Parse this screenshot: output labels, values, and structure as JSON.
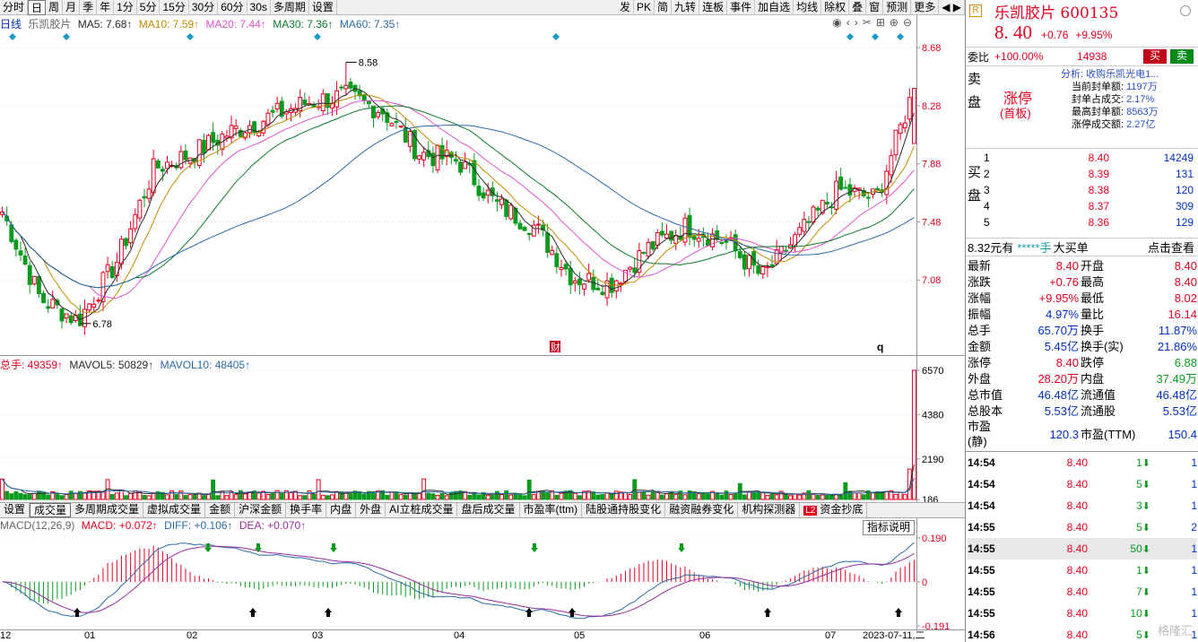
{
  "toolbar": {
    "left": [
      "分时",
      "日",
      "周",
      "月",
      "季",
      "年",
      "1分",
      "5分",
      "15分",
      "30分",
      "60分",
      "30s",
      "多周期",
      "设置"
    ],
    "right": [
      "发",
      "PK",
      "简",
      "九转",
      "连板",
      "事件",
      "加自选",
      "均线",
      "除权",
      "叠",
      "窗",
      "预测",
      "更多"
    ],
    "selected": "日"
  },
  "price_legend": {
    "kind": "日线",
    "stock": "乐凯胶片",
    "ma5": "MA5: 7.68↑",
    "ma10": "MA10: 7.59↑",
    "ma20": "MA20: 7.44↑",
    "ma30": "MA30: 7.36↑",
    "ma60": "MA60: 7.35↑"
  },
  "price_axis": [
    "8.68",
    "8.28",
    "7.88",
    "7.48",
    "7.08"
  ],
  "price_annot": {
    "high": "8.58",
    "low": "6.78",
    "marker_cai": "财",
    "marker_q": "q"
  },
  "vol_legend": {
    "total": "总手: 49359↑",
    "mavol5": "MAVOL5: 50829↑",
    "mavol10": "MAVOL10: 48405↑"
  },
  "vol_axis": [
    "6570",
    "4380",
    "2190",
    "186"
  ],
  "ind_tabs": [
    "设置",
    "成交量",
    "多周期成交量",
    "虚拟成交量",
    "金额",
    "沪深金额",
    "换手率",
    "内盘",
    "外盘",
    "AI立桩成交量",
    "盘后成交量",
    "市盈率(ttm)",
    "陆股通持股变化",
    "融资融券变化",
    "机构探测器",
    "资金抄底"
  ],
  "ind_selected": "成交量",
  "ind_badge": "L2",
  "macd_legend": {
    "name": "MACD(12,26,9)",
    "macd": "MACD: +0.072↑",
    "diff": "DIFF: +0.106↑",
    "dea": "DEA: +0.070↑"
  },
  "macd_axis": [
    "0.190",
    "0",
    "-0.191"
  ],
  "macd_help": "指标说明",
  "xaxis": [
    "12",
    "01",
    "02",
    "03",
    "04",
    "05",
    "06",
    "07",
    "2023-07-11,二"
  ],
  "colors": {
    "up": "#e4001e",
    "down": "#0a9a1f",
    "ma5": "#2a2a2a",
    "ma10": "#c48a00",
    "ma20": "#e052d0",
    "ma30": "#0a7a2a",
    "ma60": "#2a6aa8"
  },
  "chart_data": {
    "type": "candlestick",
    "title": "乐凯胶片 日线",
    "xlabel": "",
    "ylabel": "",
    "ylim": [
      6.68,
      8.78
    ],
    "x": [
      "12",
      "01",
      "02",
      "03",
      "04",
      "05",
      "06",
      "07"
    ],
    "keypoints": [
      {
        "x": "12",
        "close": 7.55
      },
      {
        "x": "12",
        "close": 6.95
      },
      {
        "x": "12",
        "close": 6.8
      },
      {
        "x": "01",
        "close": 7.2
      },
      {
        "x": "01",
        "close": 7.85
      },
      {
        "x": "01",
        "close": 7.95
      },
      {
        "x": "02",
        "close": 8.1
      },
      {
        "x": "02",
        "close": 8.2
      },
      {
        "x": "02",
        "close": 8.3
      },
      {
        "x": "03",
        "close": 8.35
      },
      {
        "x": "03",
        "close": 8.25
      },
      {
        "x": "03",
        "close": 7.95
      },
      {
        "x": "04",
        "close": 7.9
      },
      {
        "x": "04",
        "close": 7.6
      },
      {
        "x": "04",
        "close": 7.45
      },
      {
        "x": "05",
        "close": 7.1
      },
      {
        "x": "05",
        "close": 7.05
      },
      {
        "x": "05",
        "close": 7.3
      },
      {
        "x": "06",
        "close": 7.45
      },
      {
        "x": "06",
        "close": 7.35
      },
      {
        "x": "06",
        "close": 7.1
      },
      {
        "x": "07",
        "close": 7.4
      },
      {
        "x": "07",
        "close": 7.7
      },
      {
        "x": "07",
        "close": 7.64
      },
      {
        "x": "07",
        "close": 8.4
      }
    ],
    "annotations": {
      "high": 8.58,
      "low": 6.78
    },
    "last_close": 8.4,
    "volume_ylim": [
      186,
      6570
    ],
    "macd_ylim": [
      -0.191,
      0.19
    ]
  },
  "rp": {
    "logo": "R",
    "name": "乐凯胶片",
    "code": "600135",
    "price": "8. 40",
    "change": "+0.76",
    "pct": "+9.95%",
    "weibi_label": "委比",
    "weibi_pct": "+100.00%",
    "weibi_val": "14938",
    "buy_btn": "买",
    "sell_btn": "卖",
    "sell_side": "卖盘",
    "buy_side": "买盘",
    "limit_title": "涨停",
    "limit_sub": "(首板)",
    "limit_info": {
      "analysis": "分析: 收购乐凯光电1...",
      "rows": [
        [
          "当前封单额:",
          "1197万"
        ],
        [
          "封单占成交:",
          "2.17%"
        ],
        [
          "最高封单额:",
          "8563万"
        ],
        [
          "涨停成交额:",
          "2.27亿"
        ]
      ]
    },
    "bids": [
      [
        "1",
        "8.40",
        "14249"
      ],
      [
        "2",
        "8.39",
        "131"
      ],
      [
        "3",
        "8.38",
        "120"
      ],
      [
        "4",
        "8.37",
        "309"
      ],
      [
        "5",
        "8.36",
        "129"
      ]
    ],
    "bigorder": {
      "price": "8.32元有",
      "stars": "*****手",
      "label": "大买单",
      "link": "点击查看"
    },
    "stats": [
      [
        "最新",
        "8.40",
        "开盘",
        "8.40"
      ],
      [
        "涨跌",
        "+0.76",
        "最高",
        "8.40"
      ],
      [
        "涨幅",
        "+9.95%",
        "最低",
        "8.02"
      ],
      [
        "振幅",
        "4.97%",
        "量比",
        "16.14"
      ],
      [
        "总手",
        "65.70万",
        "换手",
        "11.87%"
      ],
      [
        "金额",
        "5.45亿",
        "换手(实)",
        "21.86%"
      ],
      [
        "涨停",
        "8.40",
        "跌停",
        "6.88"
      ],
      [
        "外盘",
        "28.20万",
        "内盘",
        "37.49万"
      ],
      [
        "总市值",
        "46.48亿",
        "流通值",
        "46.48亿"
      ],
      [
        "总股本",
        "5.53亿",
        "流通股",
        "5.53亿"
      ],
      [
        "市盈(静)",
        "120.3",
        "市盈(TTM)",
        "150.4"
      ]
    ],
    "ticks": [
      [
        "14:54",
        "8.40",
        "1",
        "1"
      ],
      [
        "14:54",
        "8.40",
        "5",
        "1"
      ],
      [
        "14:54",
        "8.40",
        "3",
        "1"
      ],
      [
        "14:55",
        "8.40",
        "5",
        "2"
      ],
      [
        "14:55",
        "8.40",
        "50",
        "1"
      ],
      [
        "14:55",
        "8.40",
        "1",
        "1"
      ],
      [
        "14:55",
        "8.40",
        "7",
        "1"
      ],
      [
        "14:55",
        "8.40",
        "10",
        "1"
      ],
      [
        "14:56",
        "8.40",
        "5",
        "1"
      ]
    ],
    "watermark": "格隆汇"
  }
}
